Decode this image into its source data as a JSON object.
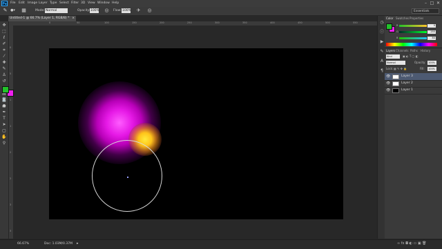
{
  "app": {
    "logo": "Ps"
  },
  "menu": [
    "File",
    "Edit",
    "Image",
    "Layer",
    "Type",
    "Select",
    "Filter",
    "3D",
    "View",
    "Window",
    "Help"
  ],
  "window_controls": [
    "–",
    "□",
    "✕"
  ],
  "options": {
    "mode_label": "Mode:",
    "mode_value": "Normal",
    "opacity_label": "Opacity:",
    "opacity_value": "100%",
    "flow_label": "Flow:",
    "flow_value": "100%"
  },
  "workspace": {
    "value": "Essentials"
  },
  "document_tab": {
    "title": "Untitled-1 @ 66.7% (Layer 1, RGB/8) *",
    "close": "×"
  },
  "tools": [
    "move",
    "marquee",
    "lasso",
    "quick-select",
    "crop",
    "eyedropper",
    "spot-heal",
    "brush",
    "stamp",
    "history-brush",
    "eraser",
    "gradient",
    "blur",
    "dodge",
    "pen",
    "type",
    "path-select",
    "shape",
    "hand",
    "zoom"
  ],
  "colors": {
    "foreground": "#22c22a",
    "background": "#ef1fef"
  },
  "ruler": {
    "top_ticks": [
      "0",
      "50",
      "100",
      "150",
      "200",
      "250",
      "300",
      "350",
      "400",
      "450",
      "500",
      "550"
    ],
    "left_ticks": [
      "0",
      "5",
      "1",
      "1",
      "2",
      "2",
      "3",
      "3"
    ]
  },
  "status": {
    "zoom": "66.67%",
    "doc": "Doc: 1.03M/0.37M"
  },
  "color_panel": {
    "tabs": [
      "Color",
      "Swatches",
      "Properties"
    ],
    "r_label": "R",
    "g_label": "G",
    "b_label": "B",
    "r_value": "0",
    "g_value": "255",
    "b_value": "84"
  },
  "layers_panel": {
    "tabs": [
      "Layers",
      "Channels",
      "Paths",
      "History"
    ],
    "kind_label": "Kind",
    "blend": "Normal",
    "opacity_label": "Opacity:",
    "opacity_value": "100%",
    "lock_label": "Lock:",
    "fill_label": "Fill:",
    "fill_value": "100%",
    "layers": [
      {
        "name": "Layer 3",
        "selected": true,
        "thumb": "#ffffff"
      },
      {
        "name": "Layer 2",
        "selected": false,
        "thumb": "#ffffff"
      },
      {
        "name": "Layer 1",
        "selected": false,
        "thumb": "#000000"
      }
    ]
  }
}
